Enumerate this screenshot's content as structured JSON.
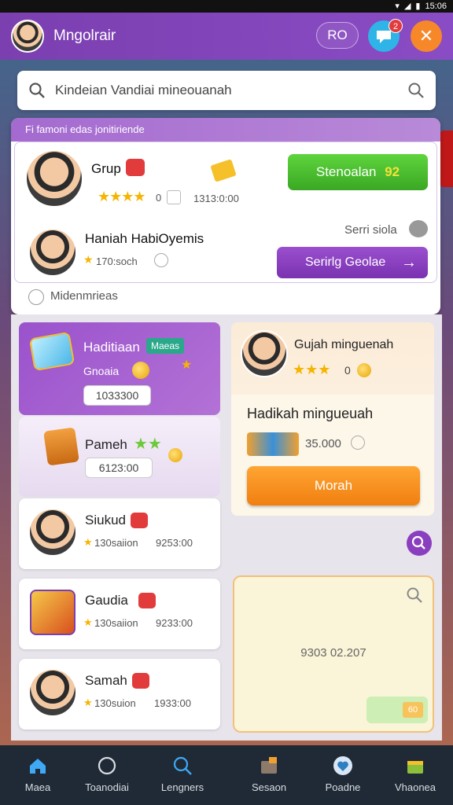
{
  "status_bar": {
    "time": "15:06"
  },
  "app_bar": {
    "title": "Mngolrair",
    "pill_label": "RO",
    "chat_badge": "2",
    "close_label": "✕"
  },
  "search": {
    "value": "Kindeian Vandiai mineouanah"
  },
  "panel": {
    "header": "Fi famoni edas jonitiriende",
    "rows": [
      {
        "name": "Grup",
        "rating_value": "0",
        "price": "1313:0:00",
        "button": "Stenoalan",
        "button_badge": "92"
      },
      {
        "name": "Haniah HabiOyemis",
        "meta": "170:soch",
        "side_text": "Serri siola",
        "button": "Serirlg Geolae"
      }
    ],
    "footer": "Midenmrieas"
  },
  "tiles": [
    {
      "title": "Haditiaan",
      "tag": "Maeas",
      "subtitle": "Gnoaia",
      "price": "1033300"
    },
    {
      "title": "Pameh",
      "price": "6123:00"
    }
  ],
  "list": [
    {
      "name": "Siukud",
      "meta": "130saiion",
      "price": "9253:00"
    },
    {
      "name": "Gaudia",
      "meta": "130saiion",
      "price": "9233:00"
    },
    {
      "name": "Samah",
      "meta": "130suion",
      "price": "1933:00"
    }
  ],
  "right_card": {
    "name": "Gujah minguenah",
    "rating_value": "0",
    "headline": "Hadikah mingueuah",
    "price": "35.000",
    "button": "Morah"
  },
  "promo_card": {
    "code": "9303 02.207",
    "mini": "60"
  },
  "bottom_nav": [
    {
      "label": "Maea"
    },
    {
      "label": "Toanodiai"
    },
    {
      "label": "Lengners"
    },
    {
      "label": "Sesaon"
    },
    {
      "label": "Poadne"
    },
    {
      "label": "Vhaonea"
    }
  ],
  "colors": {
    "brand": "#7b3fb0",
    "primary_green": "#3aa824",
    "accent_orange": "#f07f10",
    "nav_bg": "#1f2a36"
  }
}
